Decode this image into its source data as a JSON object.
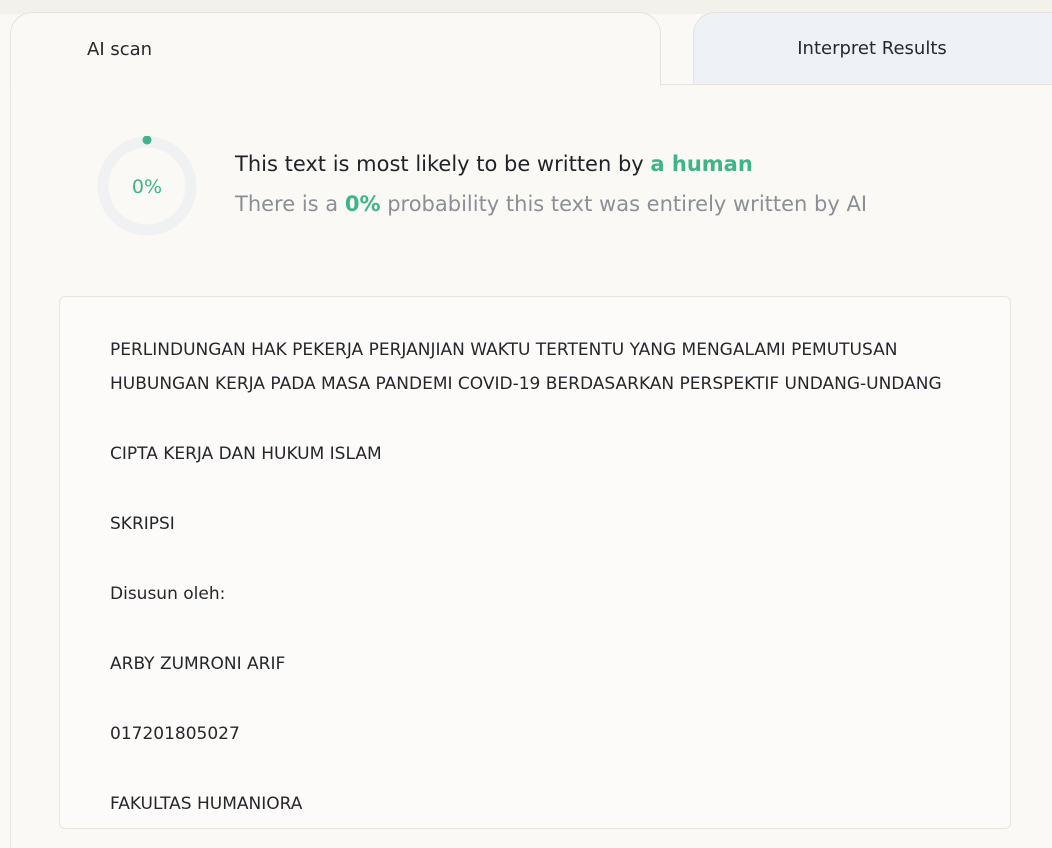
{
  "tabs": [
    {
      "label": "AI scan",
      "active": true
    },
    {
      "label": "Interpret Results",
      "active": false
    }
  ],
  "result": {
    "gauge_value": "0%",
    "gauge_fraction": 0,
    "headline_prefix": "This text is most likely to be written by",
    "headline_highlight": "a human",
    "subline_prefix": "There is a",
    "subline_highlight": "0%",
    "subline_suffix": "probability this text was entirely written by AI"
  },
  "scanned_text": {
    "paragraphs": [
      "PERLINDUNGAN HAK PEKERJA PERJANJIAN WAKTU TERTENTU YANG MENGALAMI PEMUTUSAN HUBUNGAN KERJA PADA MASA PANDEMI COVID-19 BERDASARKAN PERSPEKTIF UNDANG-UNDANG",
      "CIPTA KERJA DAN HUKUM ISLAM",
      "SKRIPSI",
      "Disusun oleh:",
      "ARBY ZUMRONI ARIF",
      "017201805027",
      "FAKULTAS HUMANIORA"
    ]
  },
  "colors": {
    "accent": "#3fb489",
    "text": "#1f2226",
    "muted": "#8b8f96",
    "tab_inactive_bg": "#eef2f6",
    "panel_bg": "#fbf9f5"
  },
  "icons": {
    "gauge": "progress-ring-icon"
  }
}
